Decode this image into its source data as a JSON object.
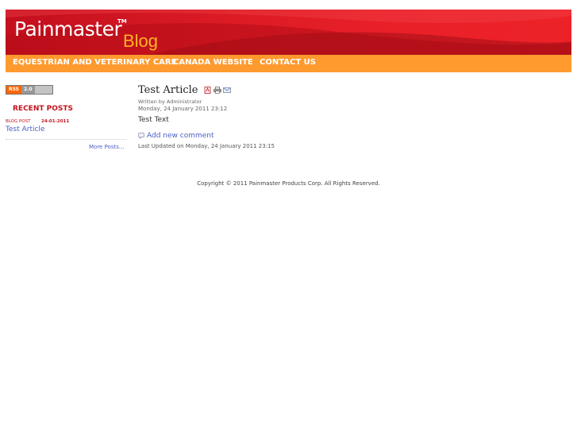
{
  "header": {
    "logo_text": "Painmaster",
    "logo_tm": "TM",
    "logo_blog": "Blog"
  },
  "nav": {
    "items": [
      {
        "label": "EQUESTRIAN AND VETERINARY CARE"
      },
      {
        "label": "CANADA WEBSITE"
      },
      {
        "label": "CONTACT US"
      }
    ]
  },
  "sidebar": {
    "rss_label": "RSS",
    "rss_version": "2.0",
    "recent_posts_title": "RECENT POSTS",
    "posts": [
      {
        "category": "BLOG POST",
        "date": "24-01-2011",
        "title": "Test Article"
      }
    ],
    "more_posts": "More Posts..."
  },
  "article": {
    "title": "Test Article",
    "author": "Written by Administrator",
    "date": "Monday, 24 January 2011 23:12",
    "body": "Test Text",
    "comment_link": "Add new comment",
    "last_updated": "Last Updated on Monday, 24 January 2011 23:15",
    "action_icons": [
      "pdf-icon",
      "print-icon",
      "email-icon"
    ]
  },
  "footer": {
    "copyright": "Copyright © 2011 Painmaster Products Corp. All Rights Reserved."
  },
  "colors": {
    "header_red": "#ed2229",
    "nav_orange": "#ff9a2e",
    "accent_red": "#c3121c",
    "link_blue": "#4b5fc6",
    "blog_gold": "#ffb421"
  }
}
